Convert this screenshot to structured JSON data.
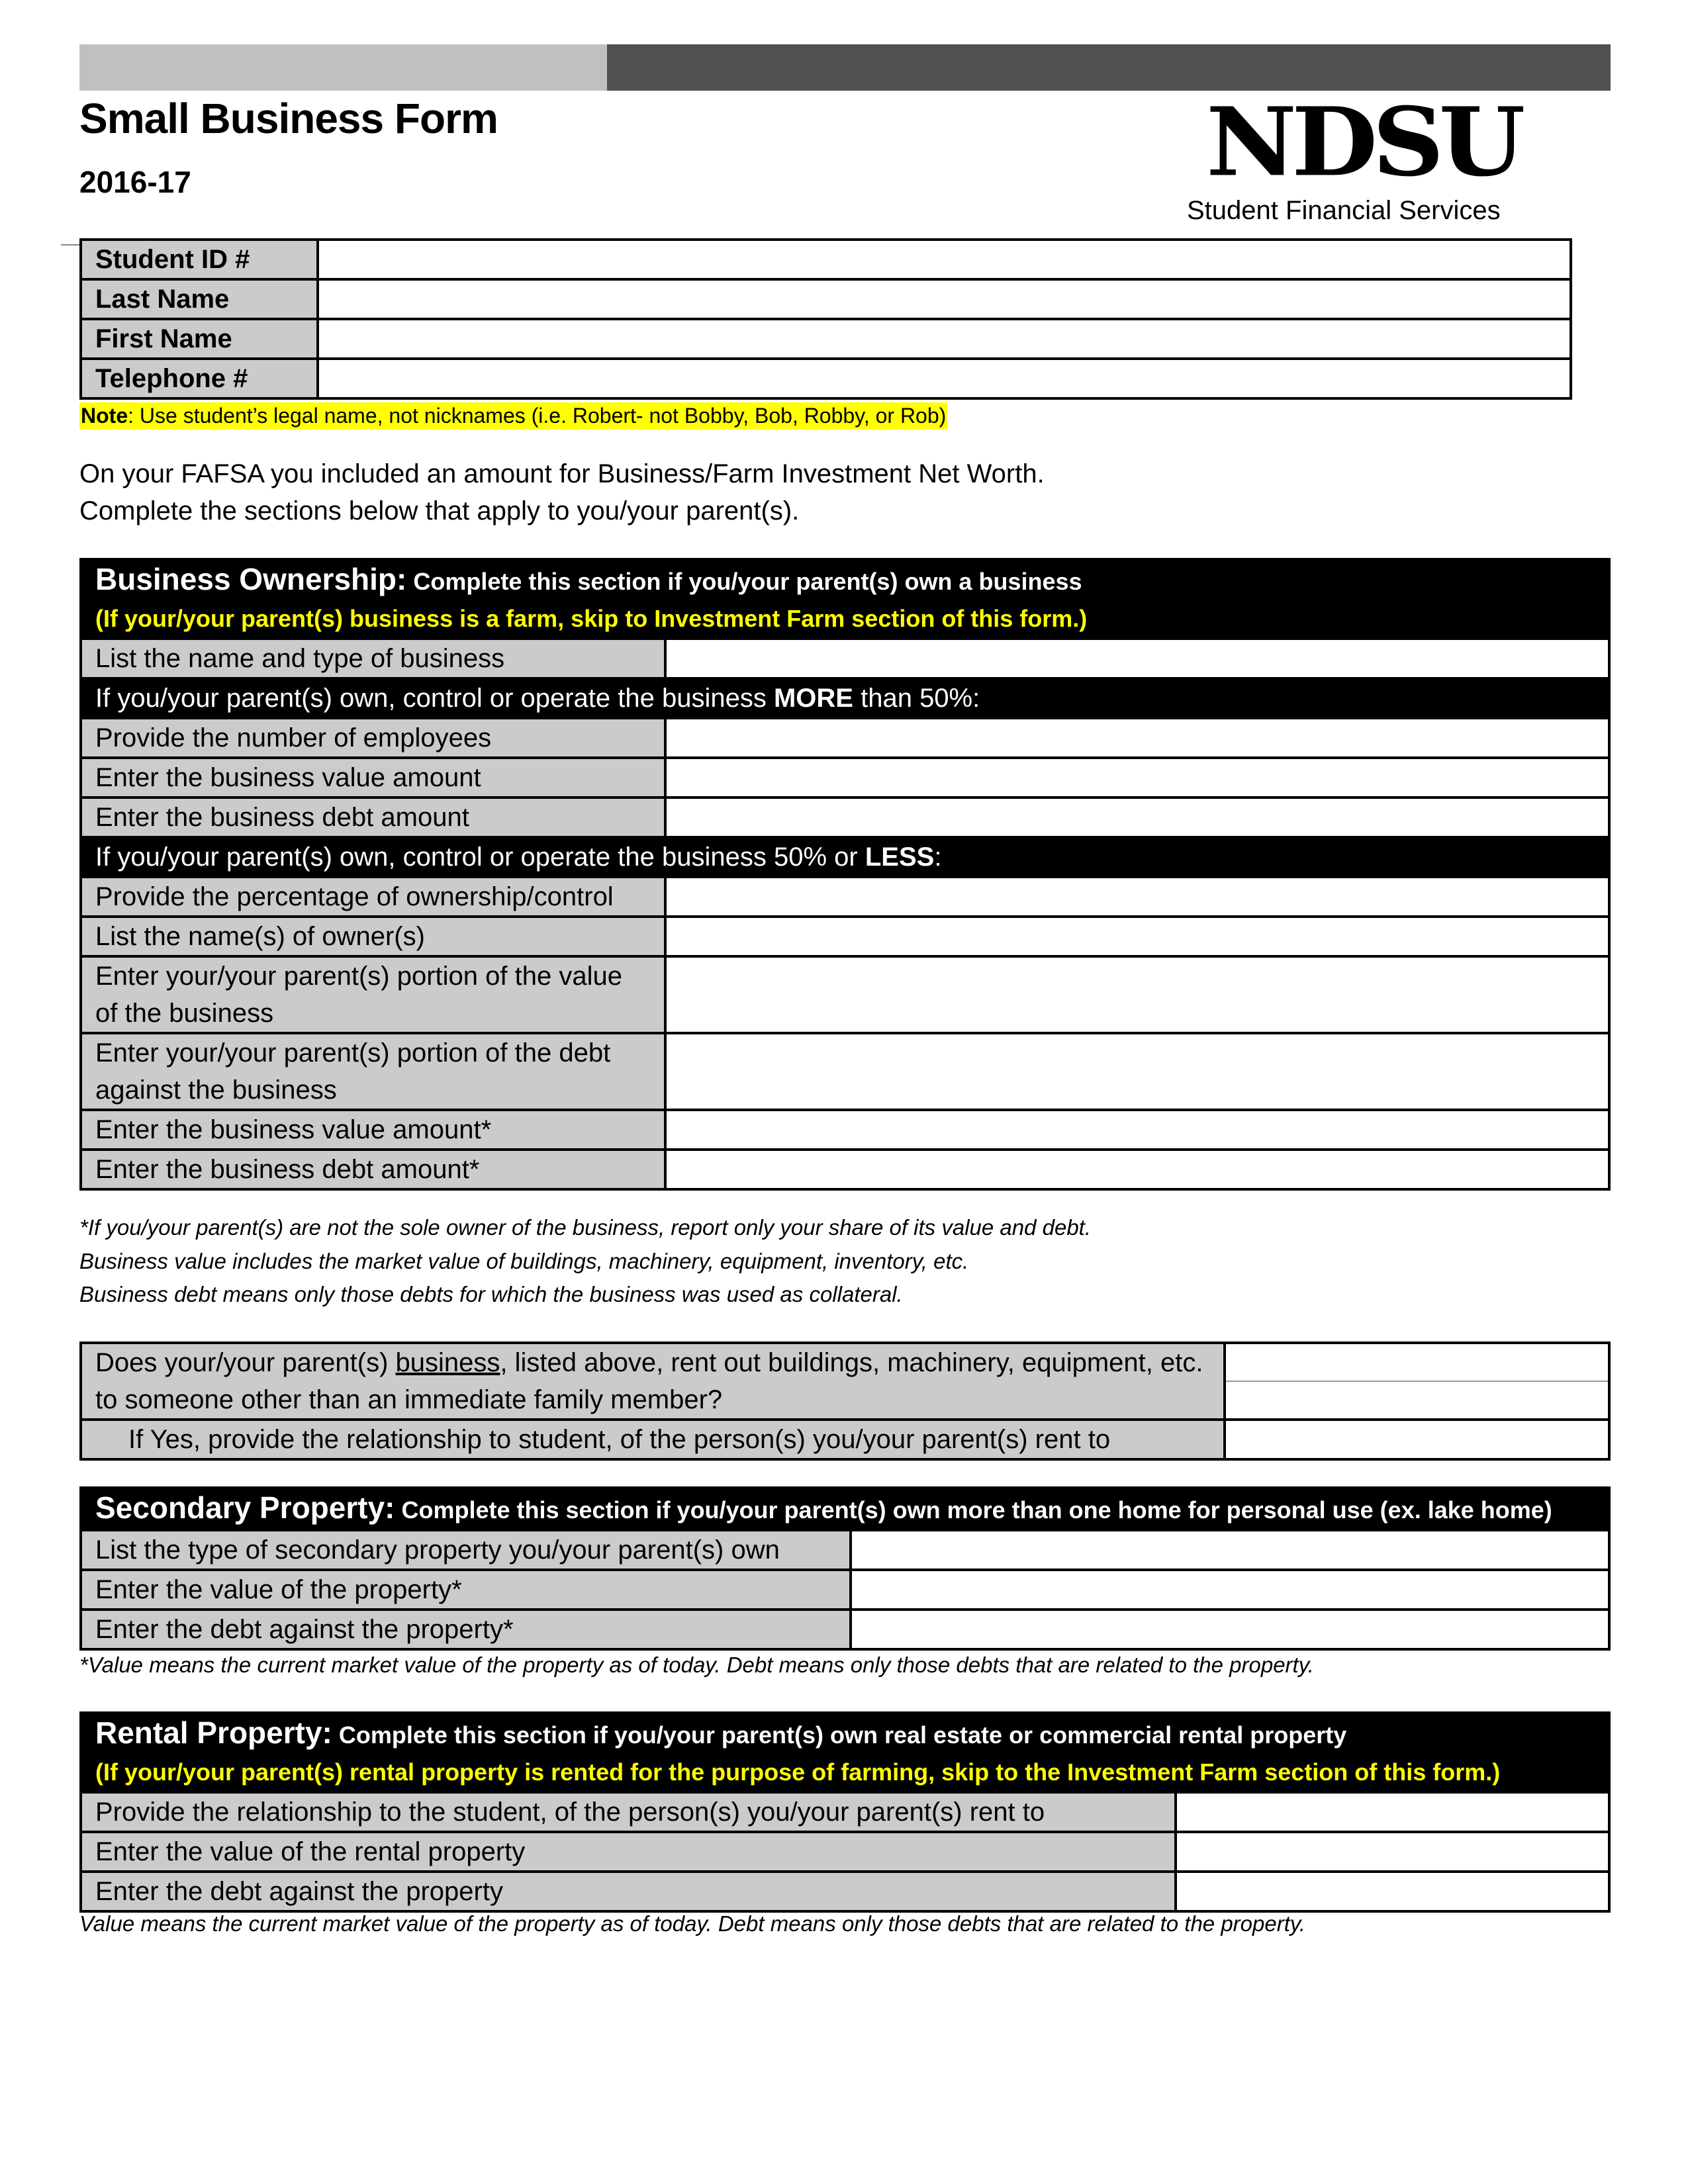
{
  "header": {
    "title": "Small Business Form",
    "year": "2016-17",
    "logo_text": "NDSU",
    "logo_subtitle": "Student Financial Services"
  },
  "student_info": {
    "fields": [
      {
        "label": "Student ID #",
        "value": ""
      },
      {
        "label": "Last Name",
        "value": ""
      },
      {
        "label": "First Name",
        "value": ""
      },
      {
        "label": "Telephone #",
        "value": ""
      }
    ],
    "note_label": "Note",
    "note_text": ": Use student’s legal name, not nicknames (i.e. Robert- not Bobby, Bob, Robby, or Rob)"
  },
  "intro": {
    "line1": "On your FAFSA you included an amount for Business/Farm Investment Net Worth.",
    "line2": "Complete the sections below that apply to you/your parent(s)."
  },
  "business_ownership": {
    "title": "Business Ownership:",
    "description": " Complete this section if you/your parent(s) own a business",
    "warning": "(If your/your parent(s) business is a farm, skip to Investment Farm section of this form.)",
    "name_row": {
      "label": "List the name and type of business",
      "value": ""
    },
    "more_band": {
      "pre": "If you/your parent(s) own, control or operate the business ",
      "bold": "MORE",
      "post": " than 50%:"
    },
    "more_rows": [
      {
        "label": "Provide the number of employees",
        "value": ""
      },
      {
        "label": "Enter the business value amount",
        "value": ""
      },
      {
        "label": "Enter the business debt amount",
        "value": ""
      }
    ],
    "less_band": {
      "pre": "If you/your parent(s) own, control or operate the business 50% or ",
      "bold": "LESS",
      "post": ":"
    },
    "less_rows": [
      {
        "label": "Provide the percentage of ownership/control",
        "value": ""
      },
      {
        "label": "List the name(s) of owner(s)",
        "value": ""
      },
      {
        "label": "Enter your/your parent(s) portion of the value of the business",
        "value": ""
      },
      {
        "label": "Enter your/your parent(s) portion of the debt against the business",
        "value": ""
      },
      {
        "label": "Enter the business value amount*",
        "value": ""
      },
      {
        "label": "Enter the business debt amount*",
        "value": ""
      }
    ],
    "footnotes": [
      "*If you/your parent(s) are not the sole owner of the business, report only your share of its value and debt.",
      "Business value includes the market value of buildings, machinery, equipment, inventory, etc.",
      "Business debt means only those debts for which the business was used as collateral."
    ]
  },
  "rent_out": {
    "question_pre": "Does your/your parent(s) ",
    "question_underlined": "business",
    "question_post": ", listed above, rent out buildings, machinery, equipment, etc. to someone other than an immediate family member?",
    "question_value": "",
    "followup": "If Yes, provide the relationship to student, of the person(s) you/your parent(s) rent to",
    "followup_value": ""
  },
  "secondary_property": {
    "title": "Secondary Property:",
    "description": " Complete this section if you/your parent(s) own more than one home for personal use (ex. lake home)",
    "rows": [
      {
        "label": "List the type of secondary property you/your parent(s) own",
        "value": ""
      },
      {
        "label": "Enter the value of the property*",
        "value": ""
      },
      {
        "label": "Enter the debt against the property*",
        "value": ""
      }
    ],
    "footnote": "*Value means the current market value of the property as of today.  Debt means only those debts that are related to the property."
  },
  "rental_property": {
    "title": "Rental Property:",
    "description": " Complete this section if you/your parent(s) own real estate or commercial rental property",
    "warning": "(If your/your parent(s) rental property is rented for the purpose of farming, skip to the Investment Farm section of this form.)",
    "rows": [
      {
        "label": "Provide the relationship to the student, of the person(s) you/your parent(s) rent to",
        "value": ""
      },
      {
        "label": "Enter the value of the rental property",
        "value": ""
      },
      {
        "label": "Enter the debt against the property",
        "value": ""
      }
    ],
    "footnote": "Value means the current market value of the property as of today.  Debt means only those debts that are related to the property."
  },
  "colors": {
    "header_bar_light": "#c0c0c0",
    "header_bar_dark": "#505050",
    "label_fill": "#cbcbcb",
    "section_header": "#000000",
    "warning_text": "#ffff00",
    "note_highlight": "#ffff00"
  }
}
